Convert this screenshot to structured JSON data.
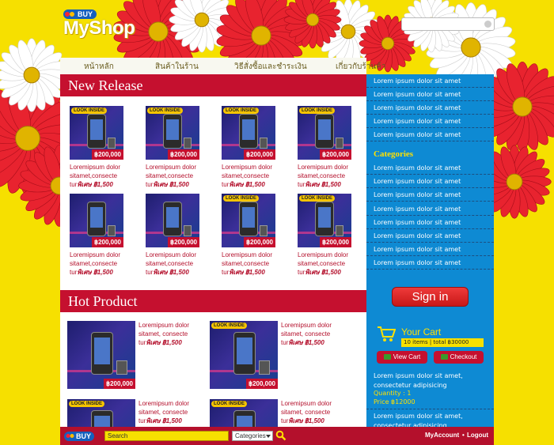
{
  "header": {
    "logo_tag": "BUY",
    "logo_name": "MyShop"
  },
  "nav": {
    "items": [
      "หน้าหลัก",
      "สินค้าในร้าน",
      "วิธีสั่งซื้อและชำระเงิน",
      "เกี่ยวกับร้านค้า"
    ]
  },
  "new_release": {
    "title": "New Release",
    "products": [
      {
        "look": "LOOK INSIDE",
        "price": "฿200,000",
        "line1": "Loremipsum dolor",
        "line2": "sitamet,consecte",
        "line3": "tur",
        "sale": "พิเศษ ฿1,500",
        "has_look": true
      },
      {
        "look": "LOOK INSIDE",
        "price": "฿200,000",
        "line1": "Loremipsum dolor",
        "line2": "sitamet,consecte",
        "line3": "tur",
        "sale": "พิเศษ ฿1,500",
        "has_look": true
      },
      {
        "look": "LOOK INSIDE",
        "price": "฿200,000",
        "line1": "Loremipsum dolor",
        "line2": "sitamet,consecte",
        "line3": "tur",
        "sale": "พิเศษ ฿1,500",
        "has_look": true
      },
      {
        "look": "LOOK INSIDE",
        "price": "฿200,000",
        "line1": "Loremipsum dolor",
        "line2": "sitamet,consecte",
        "line3": "tur",
        "sale": "พิเศษ ฿1,500",
        "has_look": true
      },
      {
        "look": "",
        "price": "฿200,000",
        "line1": "Loremipsum dolor",
        "line2": "sitamet,consecte",
        "line3": "tur",
        "sale": "พิเศษ ฿1,500",
        "has_look": false
      },
      {
        "look": "",
        "price": "฿200,000",
        "line1": "Loremipsum dolor",
        "line2": "sitamet,consecte",
        "line3": "tur",
        "sale": "พิเศษ ฿1,500",
        "has_look": false
      },
      {
        "look": "LOOK INSIDE",
        "price": "฿200,000",
        "line1": "Loremipsum dolor",
        "line2": "sitamet,consecte",
        "line3": "tur",
        "sale": "พิเศษ ฿1,500",
        "has_look": true
      },
      {
        "look": "LOOK INSIDE",
        "price": "฿200,000",
        "line1": "Loremipsum dolor",
        "line2": "sitamet,consecte",
        "line3": "tur",
        "sale": "พิเศษ ฿1,500",
        "has_look": true
      }
    ]
  },
  "hot_product": {
    "title": "Hot Product",
    "products": [
      {
        "look": "",
        "price": "฿200,000",
        "line1": "Loremipsum dolor",
        "line2": "sitamet, consecte",
        "line3": "tur",
        "sale": "พิเศษ ฿1,500",
        "has_look": false
      },
      {
        "look": "LOOK INSIDE",
        "price": "฿200,000",
        "line1": "Loremipsum dolor",
        "line2": "sitamet, consecte",
        "line3": "tur",
        "sale": "พิเศษ ฿1,500",
        "has_look": true
      },
      {
        "look": "LOOK INSIDE",
        "price": "",
        "line1": "Loremipsum dolor",
        "line2": "sitamet, consecte",
        "line3": "tur",
        "sale": "พิเศษ ฿1,500",
        "has_look": true
      },
      {
        "look": "LOOK INSIDE",
        "price": "",
        "line1": "Loremipsum dolor",
        "line2": "sitamet, consecte",
        "line3": "tur",
        "sale": "พิเศษ ฿1,500",
        "has_look": true
      }
    ]
  },
  "sidebar": {
    "top_items": [
      "Lorem ipsum dolor sit amet",
      "Lorem ipsum dolor sit amet",
      "Lorem ipsum dolor sit amet",
      "Lorem ipsum dolor sit amet",
      "Lorem ipsum dolor sit amet"
    ],
    "categories_title": "Categories",
    "category_items": [
      "Lorem ipsum dolor sit amet",
      "Lorem ipsum dolor sit amet",
      "Lorem ipsum dolor sit amet",
      "Lorem ipsum dolor sit amet",
      "Lorem ipsum dolor sit amet",
      "Lorem ipsum dolor sit amet",
      "Lorem ipsum dolor sit amet",
      "Lorem ipsum dolor sit amet"
    ],
    "signin_label": "Sign in"
  },
  "cart": {
    "title": "Your Cart",
    "summary": "10  items | total ฿30000",
    "view_label": "View Cart",
    "checkout_label": "Checkout",
    "item1_line1": "Lorem ipsum dolor sit amet,",
    "item1_line2": "consectetur adipisicing",
    "quantity": "Quantity : 1",
    "price": "Price   ฿12000",
    "item2_line1": "Lorem ipsum dolor sit amet,",
    "item2_line2": "consectetur adipisicing"
  },
  "footer": {
    "logo_tag": "BUY",
    "search_value": "Search",
    "category_select": "Categories",
    "myaccount": "MyAccount",
    "separator": "•",
    "logout": "Logout"
  },
  "colors": {
    "background": "#f6e000",
    "primary_red": "#c5102f",
    "sidebar_blue": "#0e8ad3",
    "accent_yellow": "#ffe000"
  }
}
